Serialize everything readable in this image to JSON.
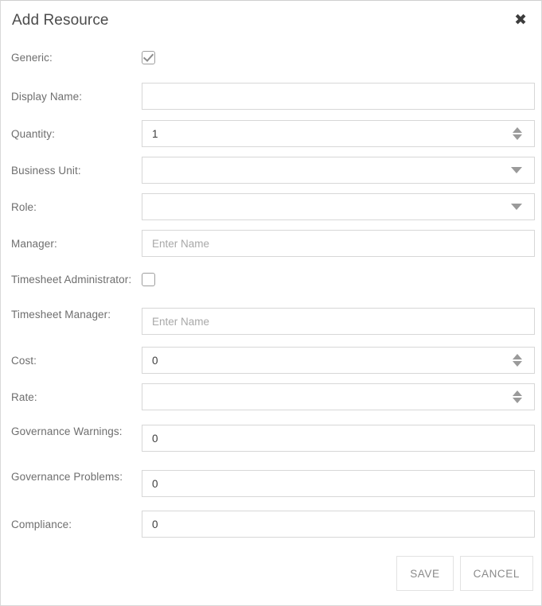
{
  "dialog": {
    "title": "Add Resource",
    "close_icon": "close-icon",
    "close_glyph": "✖"
  },
  "fields": [
    {
      "label": "Generic:",
      "type": "checkbox",
      "checked": true,
      "value": "",
      "placeholder": ""
    },
    {
      "label": "Display Name:",
      "type": "text",
      "value": "",
      "placeholder": ""
    },
    {
      "label": "Quantity:",
      "type": "spinner",
      "value": "1",
      "placeholder": ""
    },
    {
      "label": "Business Unit:",
      "type": "select",
      "value": "",
      "placeholder": ""
    },
    {
      "label": "Role:",
      "type": "select",
      "value": "",
      "placeholder": ""
    },
    {
      "label": "Manager:",
      "type": "text",
      "value": "",
      "placeholder": "Enter Name"
    },
    {
      "label": "Timesheet Administrator:",
      "type": "checkbox",
      "checked": false,
      "value": "",
      "placeholder": ""
    },
    {
      "label": "Timesheet Manager:",
      "type": "text",
      "value": "",
      "placeholder": "Enter Name"
    },
    {
      "label": "Cost:",
      "type": "spinner",
      "value": "0",
      "placeholder": ""
    },
    {
      "label": "Rate:",
      "type": "spinner",
      "value": "",
      "placeholder": ""
    },
    {
      "label": "Governance Warnings:",
      "type": "text",
      "value": "0",
      "placeholder": ""
    },
    {
      "label": "Governance Problems:",
      "type": "text",
      "value": "0",
      "placeholder": ""
    },
    {
      "label": "Compliance:",
      "type": "text",
      "value": "0",
      "placeholder": ""
    }
  ],
  "footer": {
    "save_label": "SAVE",
    "cancel_label": "CANCEL"
  },
  "colors": {
    "border": "#d7d7d7",
    "label_text": "#6e6e6e",
    "value_text": "#3b3b3b",
    "placeholder_text": "#a8a8a8",
    "button_text": "#8a8a8a",
    "arrow": "#9a9a9a"
  }
}
